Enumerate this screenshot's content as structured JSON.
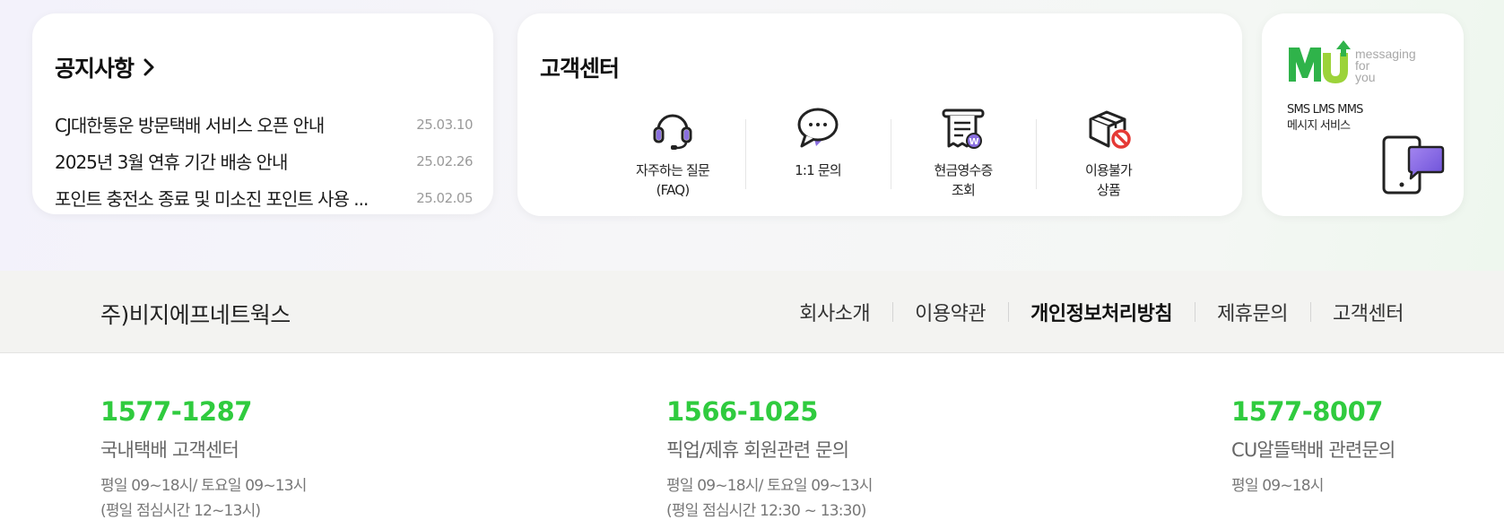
{
  "notice": {
    "title": "공지사항",
    "items": [
      {
        "text": "CJ대한통운 방문택배 서비스 오픈 안내",
        "date": "25.03.10"
      },
      {
        "text": "2025년 3월 연휴 기간 배송 안내",
        "date": "25.02.26"
      },
      {
        "text": "포인트 충전소 종료 및 미소진 포인트 사용 ...",
        "date": "25.02.05"
      }
    ]
  },
  "customer_center": {
    "title": "고객센터",
    "items": [
      {
        "label": "자주하는 질문\n(FAQ)",
        "icon": "headset-icon"
      },
      {
        "label": "1:1 문의",
        "icon": "chat-bubble-icon"
      },
      {
        "label": "현금영수증\n조회",
        "icon": "receipt-icon"
      },
      {
        "label": "이용불가\n상품",
        "icon": "prohibited-box-icon"
      }
    ]
  },
  "mu_banner": {
    "logo_text": "MU",
    "tagline_1": "messaging",
    "tagline_2": "for",
    "tagline_3": "you",
    "sub_1": "SMS LMS MMS",
    "sub_2": "메시지 서비스",
    "logo_color": "#5cbf2a"
  },
  "footer": {
    "company": "주)비지에프네트웍스",
    "links": [
      "회사소개",
      "이용약관",
      "개인정보처리방침",
      "제휴문의",
      "고객센터"
    ]
  },
  "contacts": [
    {
      "phone": "1577-1287",
      "title": "국내택배 고객센터",
      "hours_1": "평일 09~18시/ 토요일 09~13시",
      "hours_2": "(평일 점심시간 12~13시)"
    },
    {
      "phone": "1566-1025",
      "title": "픽업/제휴 회원관련 문의",
      "hours_1": "평일 09~18시/ 토요일 09~13시",
      "hours_2": "(평일 점심시간 12:30 ~ 13:30)"
    },
    {
      "phone": "1577-8007",
      "title": "CU알뜰택배 관련문의",
      "hours_1": "평일 09~18시",
      "hours_2": ""
    }
  ],
  "colors": {
    "accent_green": "#2fcb3e",
    "background_top": "#f4f4f7",
    "footer_bar": "#f3f3f1"
  }
}
